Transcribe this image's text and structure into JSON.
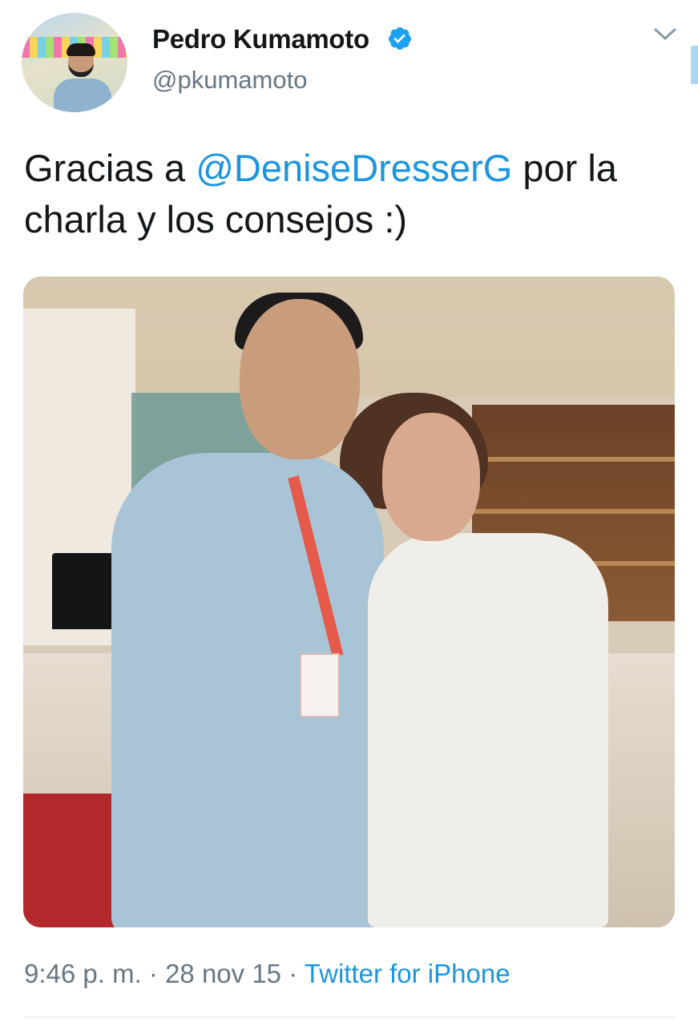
{
  "tweet": {
    "author": {
      "name": "Pedro Kumamoto",
      "handle": "@pkumamoto",
      "verified": true
    },
    "text": {
      "prefix": "Gracias a ",
      "mention": "@DeniseDresserG",
      "suffix": " por la charla y los consejos :)"
    },
    "meta": {
      "time": "9:46 p. m.",
      "separator1": " · ",
      "date": "28 nov 15",
      "separator2": " · ",
      "source": "Twitter for iPhone"
    }
  },
  "colors": {
    "link": "#1b95e0",
    "secondary_text": "#657786",
    "verified_badge": "#1da1f2"
  },
  "icons": {
    "verified": "verified-badge-icon",
    "menu": "chevron-down-icon"
  }
}
